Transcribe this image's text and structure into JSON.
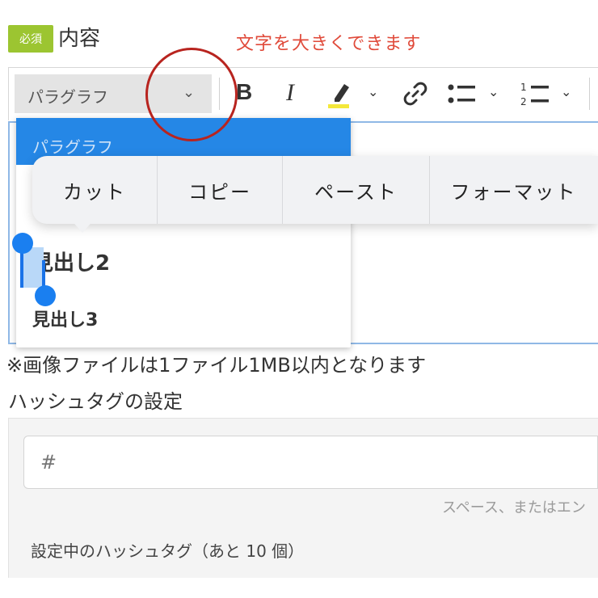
{
  "header": {
    "required_badge": "必須",
    "field_title": "内容",
    "annotation": "文字を大きくできます"
  },
  "toolbar": {
    "heading_select_value": "パラグラフ",
    "bold_label": "B",
    "italic_label": "I",
    "chevron": "⌄"
  },
  "dropdown": {
    "items": [
      "パラグラフ",
      "見出し2",
      "見出し3"
    ],
    "selected": "パラグラフ"
  },
  "context_menu": {
    "items": [
      "カット",
      "コピー",
      "ペースト",
      "フォーマット"
    ]
  },
  "notes": {
    "image_limit": "※画像ファイルは1ファイル1MB以内となります"
  },
  "hashtag": {
    "title": "ハッシュタグの設定",
    "placeholder": "#",
    "hint": "スペース、またはエン",
    "count_label": "設定中のハッシュタグ（あと 10 個）"
  },
  "colors": {
    "badge": "#9cc531",
    "annotation": "#e04a3a",
    "circle": "#b8241f",
    "selected_item": "#2587e6",
    "handle": "#1a7ff0"
  }
}
